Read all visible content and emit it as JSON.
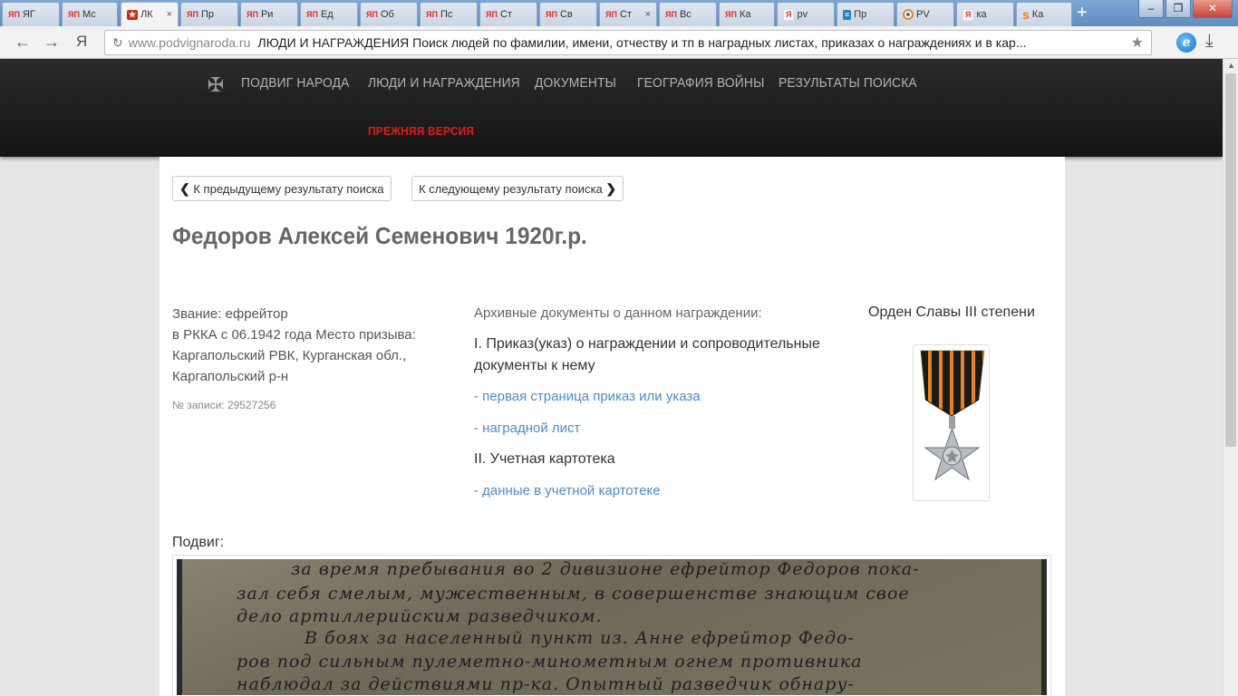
{
  "browser": {
    "tabs": [
      {
        "icon": "ЯП",
        "label": "ЯГ"
      },
      {
        "icon": "ЯП",
        "label": "Мс"
      },
      {
        "icon": "★",
        "label": "ЛК",
        "active": true,
        "close": "×"
      },
      {
        "icon": "ЯП",
        "label": "Пр"
      },
      {
        "icon": "ЯП",
        "label": "Ри"
      },
      {
        "icon": "ЯП",
        "label": "Ед"
      },
      {
        "icon": "ЯП",
        "label": "Об"
      },
      {
        "icon": "ЯП",
        "label": "Пс"
      },
      {
        "icon": "ЯП",
        "label": "Ст"
      },
      {
        "icon": "ЯП",
        "label": "Св"
      },
      {
        "icon": "ЯП",
        "label": "Ст",
        "close": "×"
      },
      {
        "icon": "ЯП",
        "label": "Вс"
      },
      {
        "icon": "ЯП",
        "label": "Ка"
      },
      {
        "icon": "Я",
        "label": "pv"
      },
      {
        "icon": "≡",
        "label": "Пр"
      },
      {
        "icon": "",
        "label": "PV"
      },
      {
        "icon": "Я",
        "label": "ка"
      },
      {
        "icon": "ѕ",
        "label": "Ка"
      }
    ],
    "new_tab": "+",
    "address": {
      "domain": "www.podvignaroda.ru",
      "title": "ЛЮДИ И НАГРАЖДЕНИЯ Поиск людей по фамилии, имени, отчеству и тп в наградных листах, приказах о награждениях и в кар..."
    }
  },
  "site": {
    "nav": {
      "home": "ПОДВИГ НАРОДА",
      "people": "ЛЮДИ И НАГРАЖДЕНИЯ",
      "documents": "ДОКУМЕНТЫ",
      "geography": "ГЕОГРАФИЯ ВОЙНЫ",
      "results": "РЕЗУЛЬТАТЫ ПОИСКА",
      "old_version": "ПРЕЖНЯЯ ВЕРСИЯ"
    }
  },
  "record": {
    "prev_button": "К предыдущему результату поиска",
    "next_button": "К следующему результату поиска",
    "name": "Федоров Алексей Семенович 1920г.р.",
    "rank": "Звание: ефрейтор",
    "service": "в РККА с 06.1942 года Место призыва: Каргапольский РВК, Курганская обл., Каргапольский р-н",
    "record_number": "№ записи: 29527256",
    "archive_heading": "Архивные документы о данном награждении:",
    "section1": "I. Приказ(указ) о награждении и сопроводительные документы к нему",
    "link_first_page": "- первая страница приказ или указа",
    "link_award_sheet": "- наградной лист",
    "section2": "II. Учетная картотека",
    "link_card_data": "- данные в учетной картотеке",
    "award_name": "Орден Славы III степени",
    "feat_label": "Подвиг:",
    "feat_lines": [
      "за время пребывания во 2 дивизионе ефрейтор Федоров пока-",
      "зал себя смелым, мужественным, в совершенстве знающим свое",
      "дело артиллерийским разведчиком.",
      "В боях за населенный пункт из. Анне ефрейтор Федо-",
      "ров под сильным пулеметно-минометным огнем противника",
      "наблюдал за действиями пр-ка. Опытный разведчик обнару-"
    ]
  },
  "colors": {
    "header_bg": "#1b1b1b",
    "nav_text": "#b4b4b4",
    "accent_red": "#e01c1c",
    "link_blue": "#4f8bc4"
  }
}
